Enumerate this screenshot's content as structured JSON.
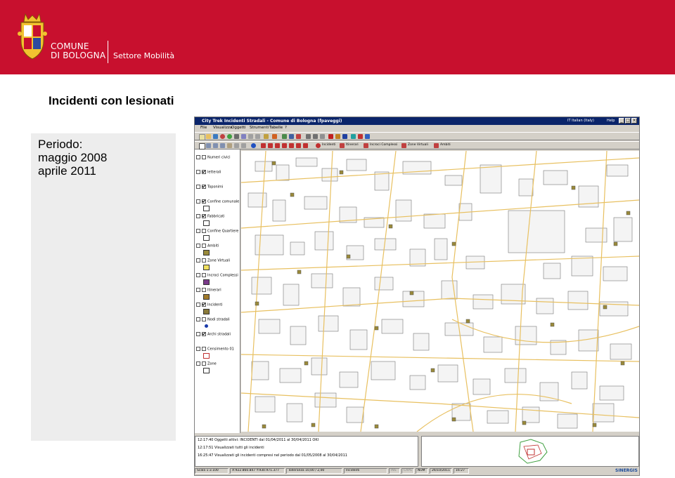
{
  "header": {
    "brand_line1": "COMUNE",
    "brand_line2": "DI BOLOGNA",
    "sector": "Settore Mobilità",
    "background_color": "#c8102e"
  },
  "page_title": "Incidenti con lesionati",
  "period": {
    "label": "Periodo:",
    "from": "maggio 2008",
    "to": "aprile 2011"
  },
  "app": {
    "window_title": "City Trek Incidenti Stradali - Comune di Bologna (fpaveggi)",
    "language": "IT Italian (Italy)",
    "help": "Help",
    "menu": [
      "File",
      "Visualizza",
      "Oggetti",
      "Strumenti",
      "Tabelle",
      "?"
    ],
    "tool_tabs": [
      "Incidenti",
      "Itinerari",
      "Incroci Complessi",
      "Zone Virtuali",
      "Ambiti"
    ],
    "legend": [
      {
        "label": "Numeri civici",
        "checked": false,
        "swatch": ""
      },
      {
        "label": "letterali",
        "checked": true,
        "swatch": ""
      },
      {
        "label": "Toponimi",
        "checked": true,
        "swatch": ""
      },
      {
        "label": "Confine comunale",
        "checked": true,
        "swatch": "#ffffff"
      },
      {
        "label": "Fabbricati",
        "checked": true,
        "swatch": "#ffffff"
      },
      {
        "label": "Confine Quartiere",
        "checked": false,
        "swatch": "#ffffff"
      },
      {
        "label": "Ambiti",
        "checked": false,
        "swatch": "#9a8a3a"
      },
      {
        "label": "Zone Virtuali",
        "checked": false,
        "swatch": "#f0e060"
      },
      {
        "label": "Incroci Complessi",
        "checked": false,
        "swatch": "#7a3a8a"
      },
      {
        "label": "Itinerari",
        "checked": false,
        "swatch": "#a07a2a"
      },
      {
        "label": "Incidenti",
        "checked": true,
        "swatch": "#8a7a3a"
      },
      {
        "label": "Nodi stradali",
        "checked": false,
        "swatch": "#1a3aaa"
      },
      {
        "label": "Archi stradali",
        "checked": true,
        "swatch": ""
      },
      {
        "label": "Censimento 01",
        "checked": false,
        "swatch": "#ffffff"
      },
      {
        "label": "Zone",
        "checked": false,
        "swatch": "#ffffff"
      }
    ],
    "log": [
      "12:17:40 Oggetti attivi: INCIDENTI dal 01/04/2011 al 30/04/2011 OKI",
      "12:17:51 Visualizzati tutti gli incidenti",
      "16:25:47 Visualizzati gli incidenti compresi nel periodo dal 01/05/2008 al 30/04/2011"
    ],
    "status": {
      "scale": "Scala 1:3.100",
      "coordinates": "X:922.860.847 Y:930.971.377",
      "tolerance": "Tolleranza 10,00 / 2,00",
      "layer": "Incidenti",
      "ins": "INS",
      "caps": "CAPS",
      "num": "NUM",
      "date": "26/10/2011",
      "time": "16:27",
      "vendor": "SINERGIS"
    }
  }
}
